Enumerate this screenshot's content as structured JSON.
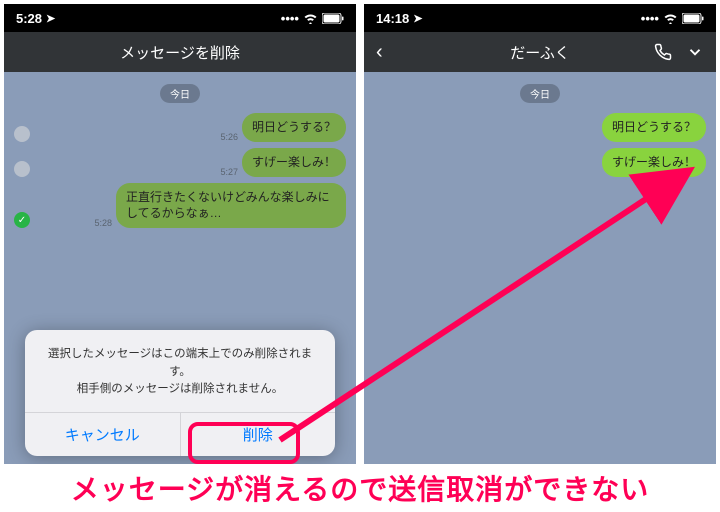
{
  "left": {
    "status": {
      "time": "5:28",
      "signal": "•••",
      "wifi": "wifi",
      "battery": "batt"
    },
    "nav": {
      "title": "メッセージを削除"
    },
    "date": "今日",
    "msgs": [
      {
        "time": "5:26",
        "text": "明日どうする？",
        "selected": false,
        "dim": true
      },
      {
        "time": "5:27",
        "text": "すげー楽しみ！",
        "selected": false,
        "dim": true
      },
      {
        "time": "5:28",
        "text": "正直行きたくないけどみんな楽しみにしてるからなぁ…",
        "selected": true,
        "dim": true
      }
    ],
    "dialog": {
      "line1": "選択したメッセージはこの端末上でのみ削除されます。",
      "line2": "相手側のメッセージは削除されません。",
      "cancel": "キャンセル",
      "delete": "削除"
    }
  },
  "right": {
    "status": {
      "time": "14:18"
    },
    "nav": {
      "title": "だーふく"
    },
    "date": "今日",
    "msgs": [
      {
        "time": "",
        "text": "明日どうする？"
      },
      {
        "time": "",
        "text": "すげー楽しみ！"
      }
    ]
  },
  "caption": "メッセージが消えるので送信取消ができない"
}
